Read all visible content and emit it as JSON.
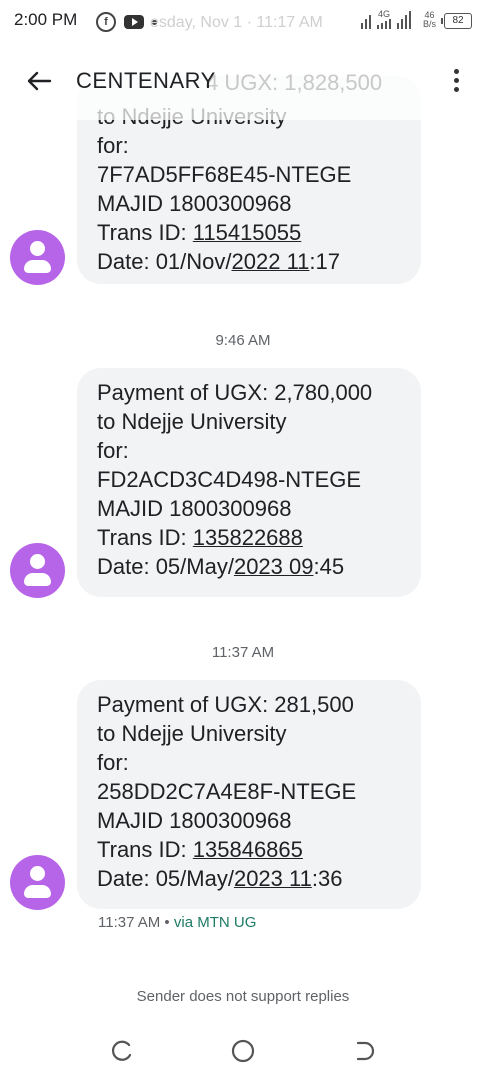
{
  "status_bar": {
    "time": "2:00 PM",
    "ghost_text": "esday, Nov 1 · 11:17 AM",
    "network": "4G",
    "speed_value": "46",
    "speed_unit": "B/s",
    "battery": "82"
  },
  "app_bar": {
    "title": "CENTENARY",
    "ghost_text": "4 UGX: 1,828,500"
  },
  "messages": [
    {
      "lines": [
        "to Ndejje University",
        "for:",
        "7F7AD5FF68E45-NTEGE",
        "MAJID 1800300968"
      ],
      "trans_label": "Trans ID: ",
      "trans_id": "115415055",
      "date_label": "Date: 01/Nov/",
      "date_link": "2022 11",
      "date_tail": ":17"
    },
    {
      "timestamp": "9:46 AM",
      "lines": [
        "Payment of UGX: 2,780,000",
        "to Ndejje University",
        "for:",
        "FD2ACD3C4D498-NTEGE",
        "MAJID 1800300968"
      ],
      "trans_label": "Trans ID: ",
      "trans_id": "135822688",
      "date_label": "Date: 05/May/",
      "date_link": "2023 09",
      "date_tail": ":45"
    },
    {
      "timestamp": "11:37 AM",
      "lines": [
        "Payment of UGX: 281,500",
        "to Ndejje University",
        "for:",
        "258DD2C7A4E8F-NTEGE",
        "MAJID 1800300968"
      ],
      "trans_label": "Trans ID: ",
      "trans_id": "135846865",
      "date_label": "Date: 05/May/",
      "date_link": "2023 11",
      "date_tail": ":36"
    }
  ],
  "meta": {
    "time": "11:37 AM",
    "separator": " • ",
    "via": "via MTN UG"
  },
  "footer": {
    "notice": "Sender does not support replies"
  },
  "colors": {
    "bubble": "#f1f3f4",
    "avatar": "#b765e8",
    "via": "#1e7b65"
  },
  "icons": [
    "back-arrow-icon",
    "more-vert-icon",
    "person-icon",
    "facebook-icon",
    "youtube-icon",
    "recents-icon",
    "home-icon",
    "back-nav-icon"
  ]
}
